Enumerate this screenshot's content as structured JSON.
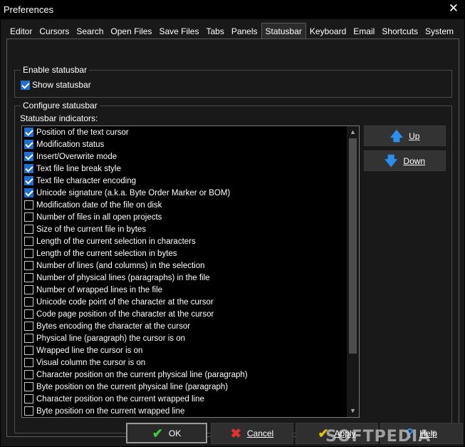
{
  "window": {
    "title": "Preferences",
    "close_glyph": "✕"
  },
  "tabs": [
    {
      "label": "Editor"
    },
    {
      "label": "Cursors"
    },
    {
      "label": "Search"
    },
    {
      "label": "Open Files"
    },
    {
      "label": "Save Files"
    },
    {
      "label": "Tabs"
    },
    {
      "label": "Panels"
    },
    {
      "label": "Statusbar",
      "active": true
    },
    {
      "label": "Keyboard"
    },
    {
      "label": "Email"
    },
    {
      "label": "Shortcuts"
    },
    {
      "label": "System"
    }
  ],
  "enable_group": {
    "title": "Enable statusbar",
    "show_statusbar": {
      "label": "Show statusbar",
      "checked": true
    }
  },
  "configure_group": {
    "title": "Configure statusbar",
    "indicators_label": "Statusbar indicators:",
    "items": [
      {
        "label": "Position of the text cursor",
        "checked": true
      },
      {
        "label": "Modification status",
        "checked": true
      },
      {
        "label": "Insert/Overwrite mode",
        "checked": true
      },
      {
        "label": "Text file line break style",
        "checked": true
      },
      {
        "label": "Text file character encoding",
        "checked": true
      },
      {
        "label": "Unicode signature (a.k.a. Byte Order Marker or BOM)",
        "checked": true
      },
      {
        "label": "Modification date of the file on disk",
        "checked": false
      },
      {
        "label": "Number of files in all open projects",
        "checked": false
      },
      {
        "label": "Size of the current file in bytes",
        "checked": false
      },
      {
        "label": "Length of the current selection in characters",
        "checked": false
      },
      {
        "label": "Length of the current selection in bytes",
        "checked": false
      },
      {
        "label": "Number of lines (and columns) in the selection",
        "checked": false
      },
      {
        "label": "Number of physical lines (paragraphs) in the file",
        "checked": false
      },
      {
        "label": "Number of wrapped lines in the file",
        "checked": false
      },
      {
        "label": "Unicode code point of the character at the cursor",
        "checked": false
      },
      {
        "label": "Code page position of the character at the cursor",
        "checked": false
      },
      {
        "label": "Bytes encoding the character at the cursor",
        "checked": false
      },
      {
        "label": "Physical line (paragraph) the cursor is on",
        "checked": false
      },
      {
        "label": "Wrapped line the cursor is on",
        "checked": false
      },
      {
        "label": "Visual column the cursor is on",
        "checked": false
      },
      {
        "label": "Character position on the current physical line (paragraph)",
        "checked": false
      },
      {
        "label": "Byte position on the current physical line (paragraph)",
        "checked": false
      },
      {
        "label": "Character position on the current wrapped line",
        "checked": false
      },
      {
        "label": "Byte position on the current wrapped line",
        "checked": false
      }
    ],
    "up_button": {
      "label": "Up",
      "icon": "arrow-up-icon",
      "glyph": "🡅"
    },
    "down_button": {
      "label": "Down",
      "icon": "arrow-down-icon",
      "glyph": "🡇"
    }
  },
  "footer": {
    "ok": {
      "label": "OK",
      "glyph": "✔"
    },
    "cancel": {
      "label": "Cancel",
      "glyph": "✖"
    },
    "apply": {
      "label": "Apply",
      "glyph": "✔"
    },
    "help": {
      "label": "Help",
      "glyph": "?"
    }
  },
  "watermark": {
    "text": "SOFTPEDIA",
    "mark": "®"
  },
  "colors": {
    "accent": "#1f6fd1",
    "ok": "#3ec93e",
    "cancel": "#e53030",
    "apply": "#e8c000",
    "arrow": "#2b8ff0"
  }
}
